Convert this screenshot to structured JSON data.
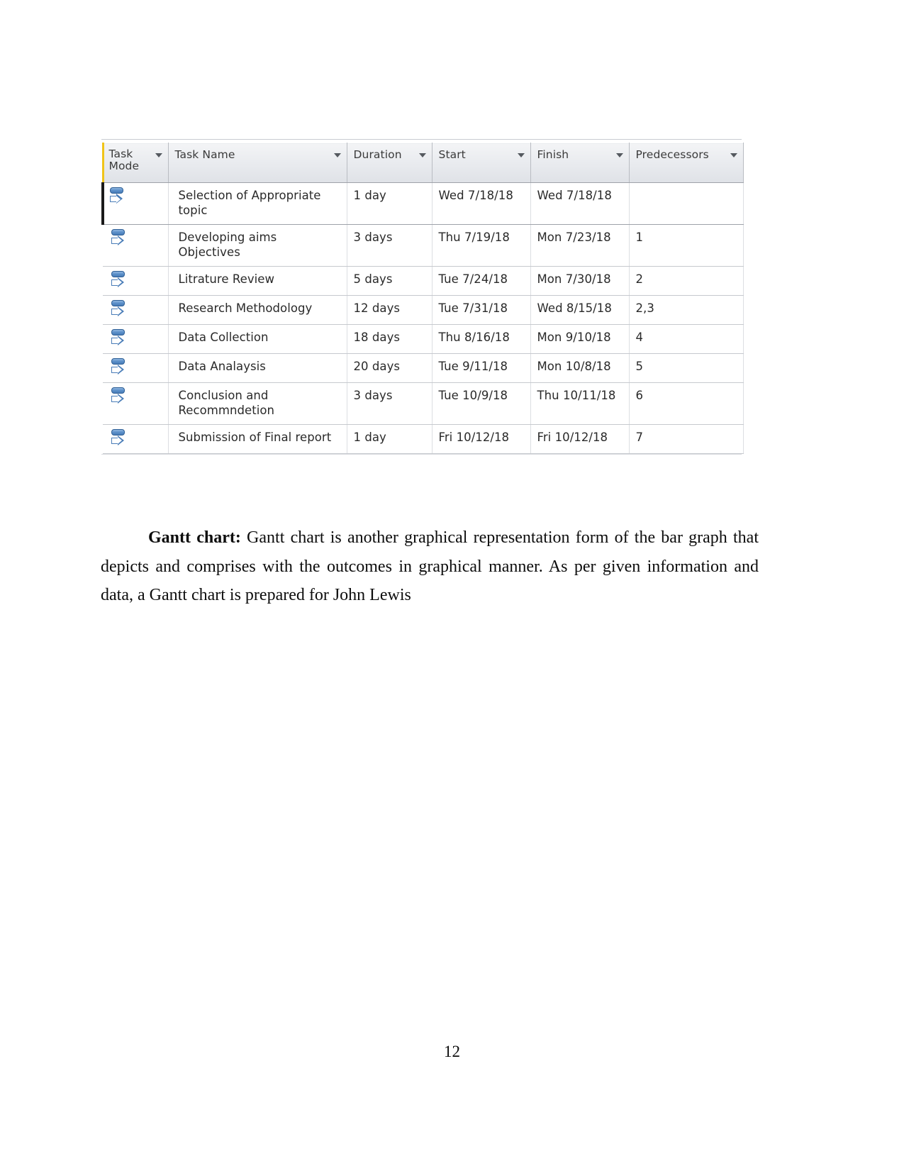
{
  "document": {
    "page_number": "12",
    "paragraph": {
      "lead_label": "Gantt chart:",
      "text": " Gantt chart is another graphical representation form of the bar graph that depicts and comprises with the outcomes in graphical manner. As per given information and data, a Gantt chart is prepared for John Lewis"
    }
  },
  "project_table": {
    "columns": [
      {
        "key": "task_mode",
        "label": "Task Mode",
        "has_filter": true
      },
      {
        "key": "task_name",
        "label": "Task Name",
        "has_filter": true
      },
      {
        "key": "duration",
        "label": "Duration",
        "has_filter": true
      },
      {
        "key": "start",
        "label": "Start",
        "has_filter": true
      },
      {
        "key": "finish",
        "label": "Finish",
        "has_filter": true
      },
      {
        "key": "predecessors",
        "label": "Predecessors",
        "has_filter": true
      }
    ],
    "task_mode_icon": "manually-scheduled-task-icon",
    "rows": [
      {
        "task_name": "Selection of Appropriate topic",
        "duration": "1 day",
        "start": "Wed 7/18/18",
        "finish": "Wed 7/18/18",
        "predecessors": ""
      },
      {
        "task_name": "Developing aims Objectives",
        "duration": "3 days",
        "start": "Thu 7/19/18",
        "finish": "Mon 7/23/18",
        "predecessors": "1"
      },
      {
        "task_name": "Litrature Review",
        "duration": "5 days",
        "start": "Tue 7/24/18",
        "finish": "Mon 7/30/18",
        "predecessors": "2"
      },
      {
        "task_name": "Research Methodology",
        "duration": "12 days",
        "start": "Tue 7/31/18",
        "finish": "Wed 8/15/18",
        "predecessors": "2,3"
      },
      {
        "task_name": "Data Collection",
        "duration": "18 days",
        "start": "Thu 8/16/18",
        "finish": "Mon 9/10/18",
        "predecessors": "4"
      },
      {
        "task_name": "Data Analaysis",
        "duration": "20 days",
        "start": "Tue 9/11/18",
        "finish": "Mon 10/8/18",
        "predecessors": "5"
      },
      {
        "task_name": "Conclusion and Recommndetion",
        "duration": "3 days",
        "start": "Tue 10/9/18",
        "finish": "Thu 10/11/18",
        "predecessors": "6"
      },
      {
        "task_name": "Submission of Final report",
        "duration": "1 day",
        "start": "Fri 10/12/18",
        "finish": "Fri 10/12/18",
        "predecessors": "7"
      }
    ]
  },
  "colors": {
    "header_accent": "#f0c419",
    "selection_bar": "#1a1a1a",
    "icon_blue": "#4a7db8",
    "header_bg": "#e8eaee",
    "grid_line": "#c6c9ce"
  }
}
